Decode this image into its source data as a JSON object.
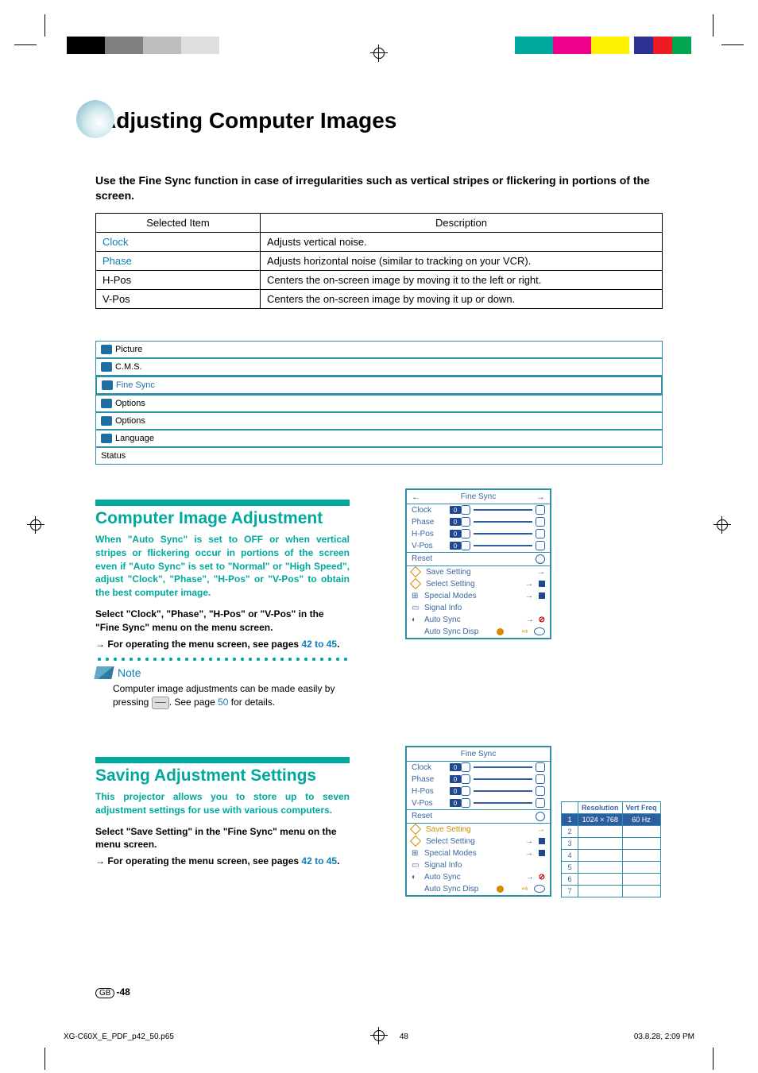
{
  "page_title": "Adjusting Computer Images",
  "intro": "Use the Fine Sync function in case of irregularities such as vertical stripes or flickering in portions of the screen.",
  "defs_table": {
    "headers": [
      "Selected Item",
      "Description"
    ],
    "rows": [
      {
        "term": "Clock",
        "desc": "Adjusts vertical noise.",
        "link": true
      },
      {
        "term": "Phase",
        "desc": "Adjusts horizontal noise (similar to tracking on your VCR).",
        "link": true
      },
      {
        "term": "H-Pos",
        "desc": "Centers the on-screen image by moving it to the left or right.",
        "link": false
      },
      {
        "term": "V-Pos",
        "desc": "Centers the on-screen image by moving it up or down.",
        "link": false
      }
    ]
  },
  "tabs": [
    {
      "label": "Picture",
      "active": false
    },
    {
      "label": "C.M.S.",
      "active": false
    },
    {
      "label": "Fine Sync",
      "active": true
    },
    {
      "label": "Options",
      "active": false
    },
    {
      "label": "Options",
      "active": false
    },
    {
      "label": "Language",
      "active": false
    },
    {
      "label": "Status",
      "active": false
    }
  ],
  "sec1": {
    "title": "Computer Image Adjustment",
    "teal": "When \"Auto Sync\" is set to OFF or when vertical stripes or flickering occur in portions of the screen even if \"Auto Sync\" is set to \"Normal\" or \"High Speed\", adjust \"Clock\", \"Phase\", \"H-Pos\" or \"V-Pos\" to obtain the best computer image.",
    "body1": "Select \"Clock\", \"Phase\", \"H-Pos\" or \"V-Pos\" in the \"Fine Sync\" menu  on the menu screen.",
    "body2_prefix": "→ For operating the menu screen, see pages ",
    "body2_link": "42 to 45",
    "body2_suffix": ".",
    "note_label": "Note",
    "note_body_prefix": "Computer image adjustments can be made easily by pressing ",
    "note_body_mid": ". See page ",
    "note_page": "50",
    "note_body_suffix": " for details."
  },
  "sec2": {
    "title": "Saving Adjustment Settings",
    "teal": "This projector allows you to store up to seven adjustment settings for use with various computers.",
    "body1": "Select \"Save Setting\" in the \"Fine Sync\" menu on the menu screen.",
    "body2_prefix": "→ For operating the menu screen, see pages ",
    "body2_link": "42 to 45",
    "body2_suffix": "."
  },
  "osd": {
    "title": "Fine Sync",
    "rows_top": [
      {
        "label": "Clock",
        "value": "0"
      },
      {
        "label": "Phase",
        "value": "0"
      },
      {
        "label": "H-Pos",
        "value": "0"
      },
      {
        "label": "V-Pos",
        "value": "0"
      }
    ],
    "reset": "Reset",
    "items": [
      {
        "label": "Save Setting"
      },
      {
        "label": "Select Setting"
      },
      {
        "label": "Special Modes"
      },
      {
        "label": "Signal Info"
      },
      {
        "label": "Auto Sync"
      },
      {
        "label": "Auto Sync Disp"
      }
    ]
  },
  "res_table": {
    "headers": [
      "",
      "Resolution",
      "Vert Freq"
    ],
    "rows": [
      {
        "n": "1",
        "res": "1024 × 768",
        "freq": "60 Hz"
      },
      {
        "n": "2",
        "res": "",
        "freq": ""
      },
      {
        "n": "3",
        "res": "",
        "freq": ""
      },
      {
        "n": "4",
        "res": "",
        "freq": ""
      },
      {
        "n": "5",
        "res": "",
        "freq": ""
      },
      {
        "n": "6",
        "res": "",
        "freq": ""
      },
      {
        "n": "7",
        "res": "",
        "freq": ""
      }
    ]
  },
  "page_number": "-48",
  "gb": "GB",
  "doc_meta": {
    "file": "XG-C60X_E_PDF_p42_50.p65",
    "page": "48",
    "timestamp": "03.8.28, 2:09 PM"
  }
}
